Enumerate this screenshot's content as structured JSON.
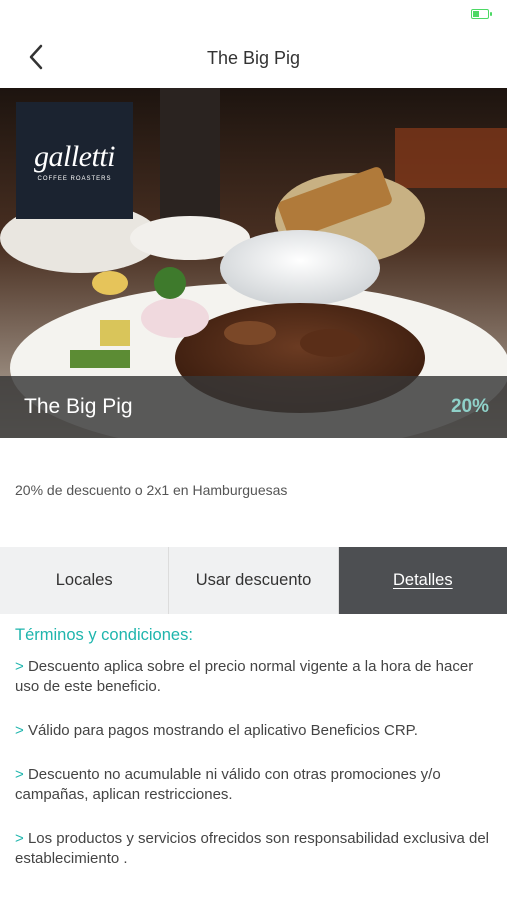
{
  "nav": {
    "title": "The Big Pig"
  },
  "hero": {
    "logo_word": "galletti",
    "logo_sub": "COFFEE ROASTERS",
    "title": "The Big Pig",
    "discount": "20%"
  },
  "description": "20% de descuento o 2x1 en Hamburguesas",
  "tabs": [
    {
      "label": "Locales"
    },
    {
      "label": "Usar descuento"
    },
    {
      "label": "Detalles"
    }
  ],
  "terms": {
    "heading": "Términos y condiciones:",
    "marker": ">",
    "items": [
      "Descuento aplica sobre el precio normal vigente a la hora de hacer uso de este beneficio.",
      "Válido para pagos mostrando el aplicativo Beneficios CRP.",
      "Descuento no acumulable ni válido con otras promociones y/o campañas, aplican restricciones.",
      "Los productos y servicios ofrecidos son responsabilidad exclusiva del establecimiento ."
    ]
  },
  "colors": {
    "accent": "#1fb5ad",
    "discount": "#8fd1c9",
    "active_tab": "#4d4f52",
    "battery": "#4cd964"
  },
  "icons": {
    "back": "chevron-left-icon",
    "battery": "battery-icon"
  }
}
